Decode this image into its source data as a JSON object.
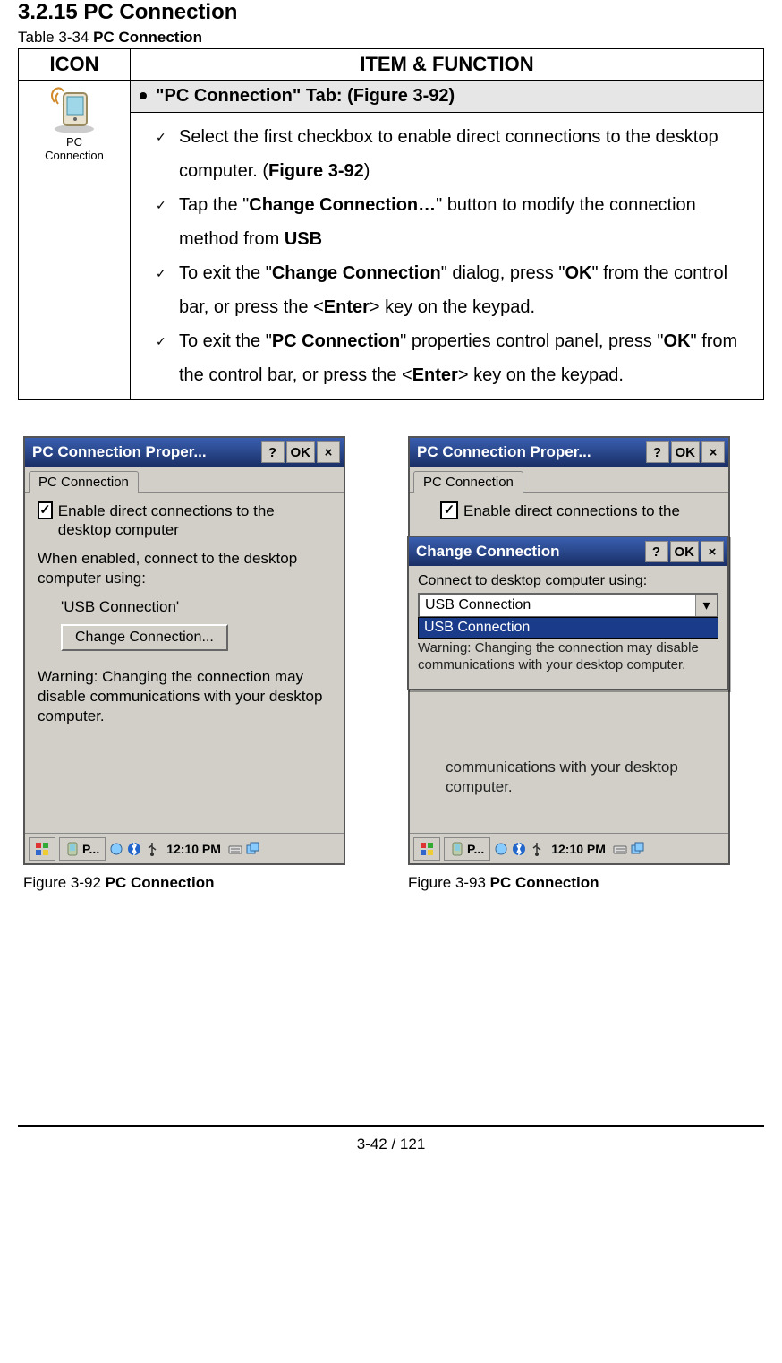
{
  "section": {
    "number": "3.2.15",
    "title": "PC Connection"
  },
  "tableCaption": {
    "prefix": "Table 3-34 ",
    "name": "PC Connection"
  },
  "tableHeaders": {
    "icon": "ICON",
    "item": "ITEM & FUNCTION"
  },
  "iconLabel": "PC Connection",
  "tabHeader": "\"PC Connection\" Tab: (Figure 3-92)",
  "items": [
    {
      "pre": "Select the first checkbox to enable direct connections to the desktop computer. (",
      "b1": "Figure 3-92",
      "post": ")"
    },
    {
      "pre": "Tap the \"",
      "b1": "Change Connection…",
      "mid1": "\" button to modify the connection method from ",
      "b2": "USB",
      "post": ""
    },
    {
      "pre": "To exit the \"",
      "b1": "Change Connection",
      "mid1": "\" dialog, press \"",
      "b2": "OK",
      "mid2": "\" from the control bar, or press the <",
      "b3": "Enter",
      "post": "> key on the keypad."
    },
    {
      "pre": "To exit the \"",
      "b1": "PC Connection",
      "mid1": "\" properties control panel, press \"",
      "b2": "OK",
      "mid2": "\" from the control bar, or press the <",
      "b3": "Enter",
      "post": "> key on the keypad."
    }
  ],
  "figA": {
    "title": "PC Connection Proper...",
    "btnHelp": "?",
    "btnOK": "OK",
    "btnClose": "×",
    "tab": "PC Connection",
    "checkboxLabel": "Enable direct connections to the desktop computer",
    "whenEnabled": "When enabled, connect to the desktop computer using:",
    "connName": "'USB Connection'",
    "changeBtn": "Change Connection...",
    "warning": "Warning: Changing the connection may disable communications with your desktop computer.",
    "taskbar": {
      "app": "P...",
      "time": "12:10 PM"
    },
    "caption": {
      "prefix": "Figure 3-92 ",
      "name": "PC Connection"
    }
  },
  "figB": {
    "title": "PC Connection Proper...",
    "btnHelp": "?",
    "btnOK": "OK",
    "btnClose": "×",
    "tab": "PC Connection",
    "checkboxLabel": "Enable direct connections to the",
    "belowDialogText": "communications with your desktop computer.",
    "dialog": {
      "title": "Change Connection",
      "btnHelp": "?",
      "btnOK": "OK",
      "btnClose": "×",
      "label": "Connect to desktop computer using:",
      "comboValue": "USB Connection",
      "option": "USB Connection",
      "warning": "Warning: Changing the connection may disable communications with your desktop computer."
    },
    "taskbar": {
      "app": "P...",
      "time": "12:10 PM"
    },
    "caption": {
      "prefix": "Figure 3-93 ",
      "name": "PC Connection"
    }
  },
  "footer": "3-42 / 121"
}
